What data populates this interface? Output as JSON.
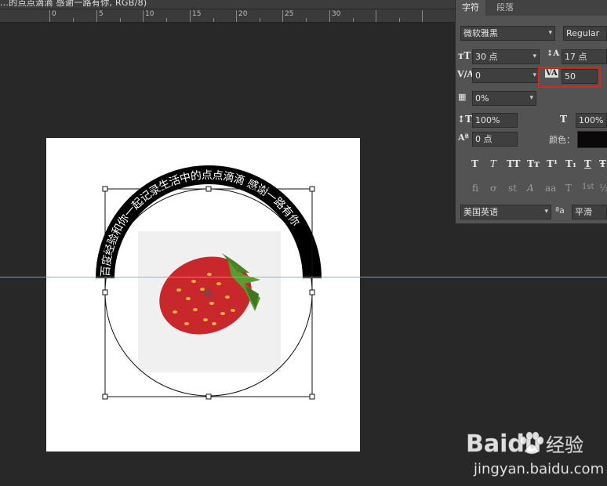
{
  "document": {
    "title": "…的点点滴滴 感谢一路有你, RGB/8)"
  },
  "ruler": {
    "labels": [
      "0",
      "5",
      "10",
      "15",
      "20",
      "25",
      "30"
    ]
  },
  "canvas": {
    "arc_text": "百度经验和你一起记录生活中的点点滴滴 感谢一路有你",
    "background_color": "#282828",
    "artboard_color": "#ffffff",
    "guide_color": "#36d0d0"
  },
  "character_panel": {
    "tabs": [
      "字符",
      "段落"
    ],
    "active_tab": "字符",
    "font_family": "微软雅黑",
    "font_style": "Regular",
    "font_size": "30 点",
    "leading": "17 点",
    "kerning": "0",
    "tracking": "50",
    "tsume": "0%",
    "vertical_scale": "100%",
    "horizontal_scale": "100%",
    "baseline_shift": "0 点",
    "color_label": "颜色：",
    "text_color": "#0a0808",
    "language": "美国英语",
    "aa_label": "ªa",
    "anti_alias": "平滑",
    "style_buttons": [
      "T",
      "T",
      "TT",
      "Tт",
      "T¹",
      "T₁",
      "T",
      "Ŧ"
    ],
    "opentype_buttons": [
      "fi",
      "ơ",
      "st",
      "A",
      "aa",
      "T",
      "1st",
      "½"
    ]
  },
  "watermark": {
    "brand": "Baidu",
    "brand_cn": "经验",
    "url": "jingyan.baidu.com"
  },
  "colors": {
    "highlight": "#d8261f",
    "panel_bg": "#535353",
    "strawberry_red": "#c8272b",
    "leaf_green": "#5a9a2e"
  }
}
